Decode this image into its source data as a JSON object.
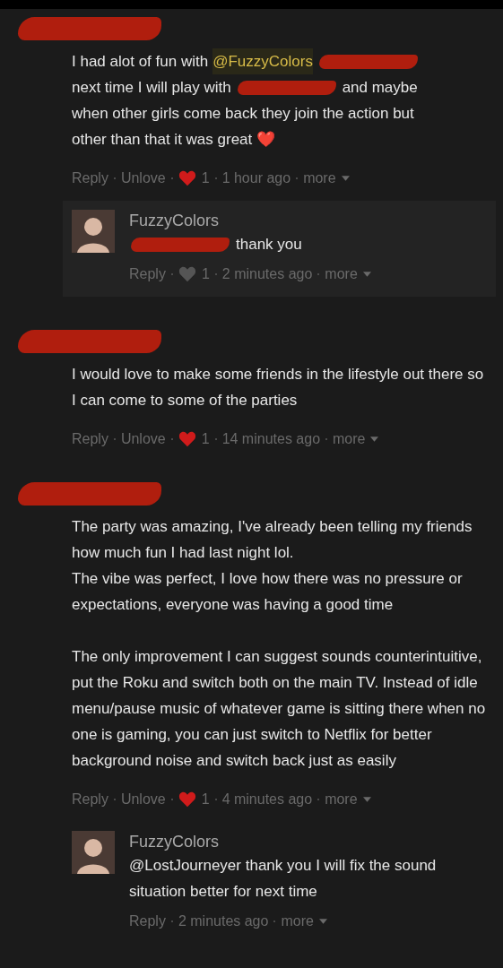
{
  "comments": [
    {
      "header_redacted": true,
      "lines": [
        {
          "segments": [
            {
              "kind": "text",
              "text": "I had alot of fun with"
            },
            {
              "kind": "mention",
              "text": "@FuzzyColors"
            },
            {
              "kind": "redacted"
            }
          ]
        },
        {
          "segments": [
            {
              "kind": "text",
              "text": "next time I will play with"
            },
            {
              "kind": "redacted"
            },
            {
              "kind": "text",
              "text": "and maybe"
            }
          ]
        },
        {
          "segments": [
            {
              "kind": "text",
              "text": "when other girls come back they join the action but"
            }
          ]
        },
        {
          "segments": [
            {
              "kind": "text",
              "text": "other than that it was great ❤️"
            }
          ]
        }
      ],
      "actions": {
        "reply": "Reply",
        "unlove": "Unlove",
        "loved": true,
        "likes": "1",
        "time": "1 hour ago",
        "more": "more"
      },
      "replies": [
        {
          "author": "FuzzyColors",
          "lines": [
            {
              "segments": [
                {
                  "kind": "redacted"
                },
                {
                  "kind": "text",
                  "text": "thank you"
                }
              ]
            }
          ],
          "actions": {
            "reply": "Reply",
            "loved": false,
            "likes": "1",
            "time": "2 minutes ago",
            "more": "more"
          }
        }
      ]
    },
    {
      "header_redacted": true,
      "lines": [
        {
          "segments": [
            {
              "kind": "text",
              "text": "I would love to make some friends in the lifestyle out there so I can come to some of the parties"
            }
          ]
        }
      ],
      "actions": {
        "reply": "Reply",
        "unlove": "Unlove",
        "loved": true,
        "likes": "1",
        "time": "14 minutes ago",
        "more": "more"
      }
    },
    {
      "header_redacted": true,
      "lines": [
        {
          "segments": [
            {
              "kind": "text",
              "text": "The party was amazing, I've already been telling my friends how much fun I had last night lol."
            }
          ]
        },
        {
          "segments": [
            {
              "kind": "text",
              "text": "The vibe was perfect, I love how there was no pressure or expectations, everyone was having a good time"
            }
          ]
        },
        {
          "kind": "gap"
        },
        {
          "segments": [
            {
              "kind": "text",
              "text": "The only improvement I can suggest sounds counterintuitive, put the Roku and switch both on the main TV. Instead of idle menu/pause music of whatever game is sitting there when no one is gaming, you can just switch to Netflix for better background noise and switch back just as easily"
            }
          ]
        }
      ],
      "actions": {
        "reply": "Reply",
        "unlove": "Unlove",
        "loved": true,
        "likes": "1",
        "time": "4 minutes ago",
        "more": "more"
      },
      "replies": [
        {
          "author": "FuzzyColors",
          "lines": [
            {
              "segments": [
                {
                  "kind": "text",
                  "text": "@LostJourneyer thank you I will fix the sound situation better for next time"
                }
              ]
            }
          ],
          "actions": {
            "reply": "Reply",
            "time": "2 minutes ago",
            "more": "more"
          }
        }
      ]
    }
  ]
}
